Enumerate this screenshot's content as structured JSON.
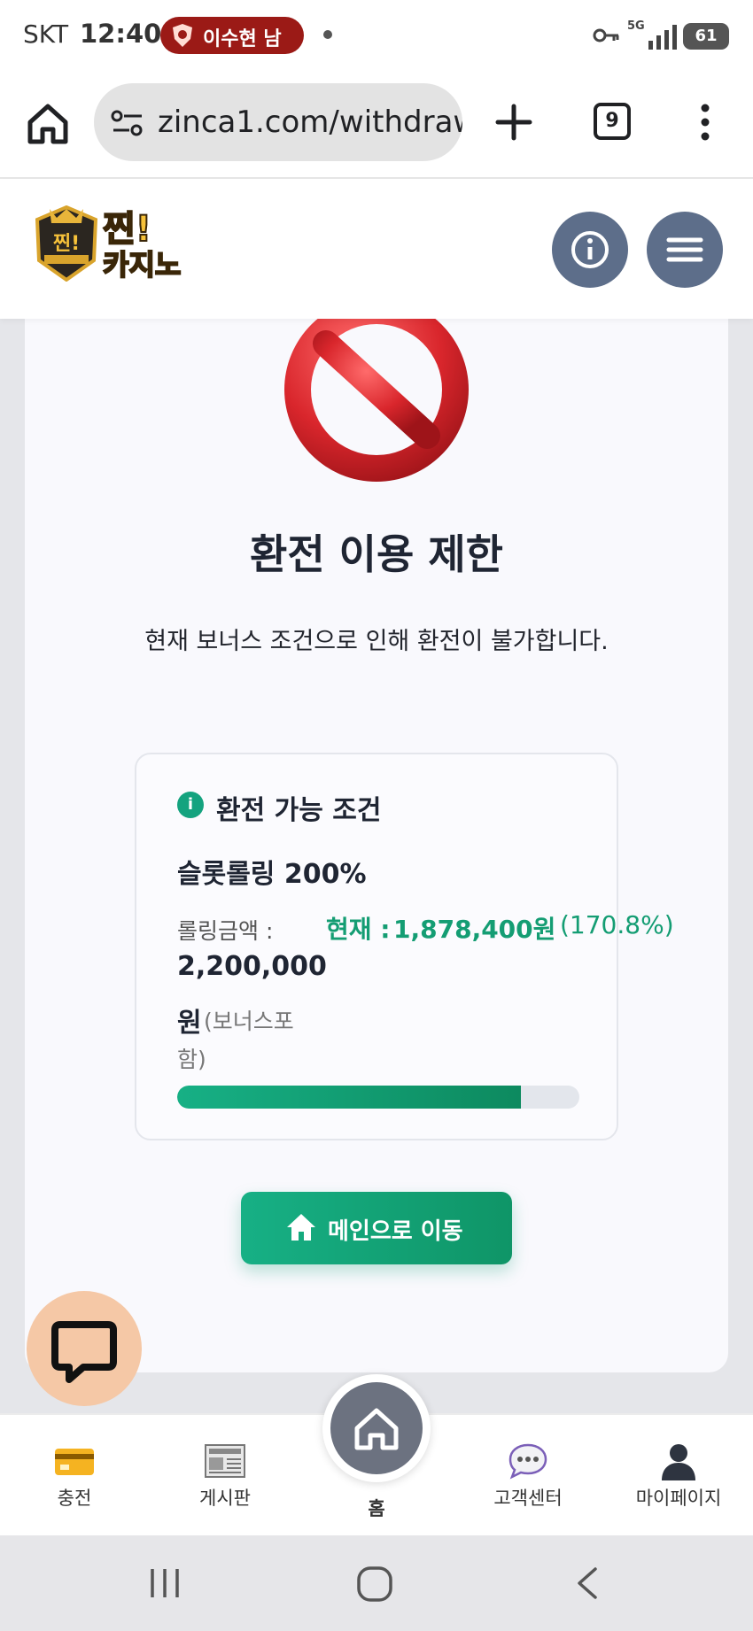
{
  "status_bar": {
    "carrier": "SKT",
    "time": "12:40",
    "recording_pill": "이수현 남",
    "battery": "61",
    "network": "5G"
  },
  "browser": {
    "url": "zinca1.com/withdraw",
    "tab_count": "9"
  },
  "site": {
    "logo_text_1": "찐!",
    "logo_text_2": "카지노"
  },
  "restriction": {
    "title": "환전 이용 제한",
    "description": "현재 보너스 조건으로 인해 환전이 불가합니다."
  },
  "conditions": {
    "title": "환전 가능 조건",
    "rule": "슬롯롤링 200%",
    "rolling_label": "롤링금액 :",
    "rolling_amount": "2,200,000",
    "rolling_unit": "원",
    "rolling_note_1": "(보너스포",
    "rolling_note_2": "함)",
    "current_label": "현재 :",
    "current_value": "1,878,400원",
    "current_percent": "(170.8%)",
    "progress_fraction": 0.854
  },
  "actions": {
    "main_button": "메인으로 이동"
  },
  "bottom_nav": {
    "items": [
      {
        "label": "충전",
        "icon": "credit-card-icon"
      },
      {
        "label": "게시판",
        "icon": "newspaper-icon"
      },
      {
        "label": "홈",
        "icon": "home-icon"
      },
      {
        "label": "고객센터",
        "icon": "speech-bubble-icon"
      },
      {
        "label": "마이페이지",
        "icon": "user-silhouette-icon"
      }
    ]
  },
  "colors": {
    "accent_green": "#149d73",
    "header_button": "#5d6e8a",
    "ban_red": "#d9262c",
    "chat_fab": "#f5c8a6"
  }
}
